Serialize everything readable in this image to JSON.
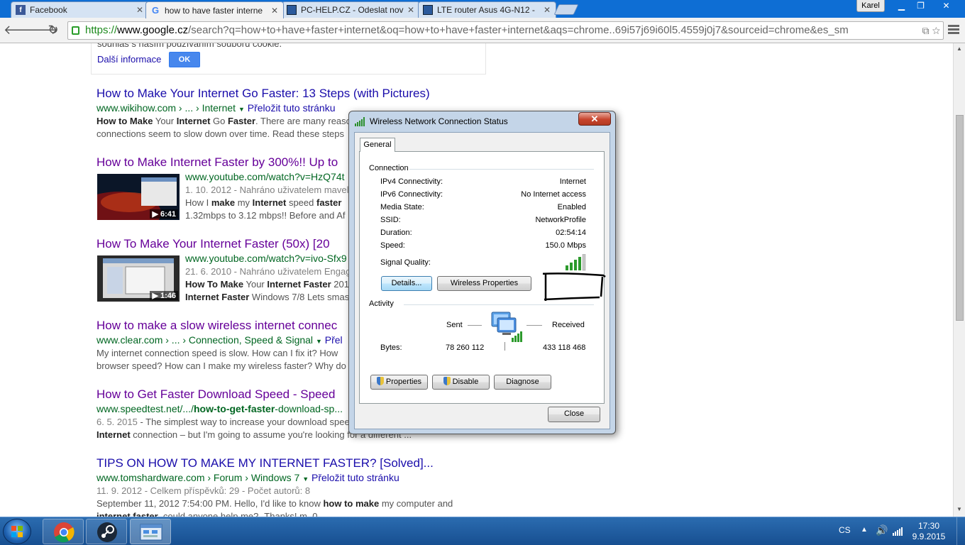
{
  "tabs": [
    {
      "title": "Facebook",
      "icon": "facebook-icon"
    },
    {
      "title": "how to have faster interne",
      "icon": "google-icon",
      "active": true
    },
    {
      "title": "PC-HELP.CZ - Odeslat nov",
      "icon": "document-icon"
    },
    {
      "title": "LTE router Asus 4G-N12 -",
      "icon": "document-icon"
    }
  ],
  "user_badge": "Karel",
  "address": {
    "scheme": "https://",
    "host": "www.google.cz",
    "rest": "/search?q=how+to+have+faster+internet&oq=how+to+have+faster+internet&aqs=chrome..69i57j69i60l5.4559j0j7&sourceid=chrome&es_sm"
  },
  "cookie_notice": {
    "text": "souhlas s naším používáním souborů cookie.",
    "more": "Další informace",
    "ok": "OK"
  },
  "results": [
    {
      "title": "How to Make Your Internet Go Faster: 13 Steps (with Pictures)",
      "url": "www.wikihow.com › ... › Internet",
      "translate": "Přeložit tuto stránku",
      "snippet_1_b": "How to Make",
      "snippet_1_a": " Your ",
      "snippet_1_b2": "Internet",
      "snippet_1_a2": " Go ",
      "snippet_1_b3": "Faster",
      "snippet_1_a3": ". There are many reaso",
      "snippet_2": "connections seem to slow down over time. Read these steps"
    },
    {
      "title": "How to Make Internet Faster by 300%!! Up to",
      "url": "www.youtube.com/watch?v=HzQ74t",
      "meta": "1. 10. 2012 - Nahráno uživatelem mavel",
      "snippet_a": "How I ",
      "snippet_b": "make",
      "snippet_c": " my ",
      "snippet_d": "Internet",
      "snippet_e": " speed ",
      "snippet_f": "faster",
      "snippet_2": "1.32mbps to 3.12 mbps!! Before and Af",
      "duration": "▶ 6:41"
    },
    {
      "title": "How To Make Your Internet Faster (50x) [20",
      "url": "www.youtube.com/watch?v=ivo-Sfx9",
      "meta": "21. 6. 2010 - Nahráno uživatelem Engag",
      "snippet_b": "How To Make",
      "snippet_a": " Your ",
      "snippet_b2": "Internet Faster",
      "snippet_a2": " 201",
      "snippet_2b": "Internet Faster",
      "snippet_2a": " Windows 7/8 Lets smas",
      "duration": "▶ 1:46"
    },
    {
      "title": "How to make a slow wireless internet connec",
      "url": "www.clear.com › ... › Connection, Speed & Signal",
      "translate": "Přel",
      "snippet_1": "My internet connection speed is slow. How can I fix it? How",
      "snippet_2": "browser speed? How can I make my wireless faster? Why do"
    },
    {
      "title": "How to Get Faster Download Speed - Speed",
      "url_a": "www.speedtest.net/.../",
      "url_b": "how-to-get-faster",
      "url_c": "-download-sp...",
      "meta": "6. 5. 2015",
      "snippet_1": " - The simplest way to increase your download spee",
      "snippet_2b": "Internet",
      "snippet_2a": " connection – but I'm going to assume you're looking for a different ..."
    },
    {
      "title": "TIPS ON HOW TO MAKE MY INTERNET FASTER? [Solved]...",
      "url": "www.tomshardware.com › Forum › Windows 7",
      "translate": "Přeložit tuto stránku",
      "meta": "11. 9. 2012 - Celkem příspěvků: 29 - Počet autorů: 8",
      "snippet_1a": "September 11, 2012 7:54:00 PM. Hello, I'd like to know ",
      "snippet_1b": "how to make",
      "snippet_1c": " my computer and",
      "snippet_2b": "internet faster",
      "snippet_2a": ", could anyone help me? -Thanks! m_0"
    }
  ],
  "dialog": {
    "title": "Wireless Network Connection Status",
    "tab": "General",
    "connection_label": "Connection",
    "rows": [
      {
        "label": "IPv4 Connectivity:",
        "value": "Internet"
      },
      {
        "label": "IPv6 Connectivity:",
        "value": "No Internet access"
      },
      {
        "label": "Media State:",
        "value": "Enabled"
      },
      {
        "label": "SSID:",
        "value": "NetworkProfile"
      },
      {
        "label": "Duration:",
        "value": "02:54:14"
      },
      {
        "label": "Speed:",
        "value": "150.0 Mbps"
      }
    ],
    "signal_label": "Signal Quality:",
    "signal_bars": 4,
    "details_button": "Details...",
    "wireless_props_button": "Wireless Properties",
    "activity_label": "Activity",
    "sent_label": "Sent",
    "received_label": "Received",
    "bytes_label": "Bytes:",
    "bytes_sent": "78 260 112",
    "bytes_received": "433 118 468",
    "properties_button": "Properties",
    "disable_button": "Disable",
    "diagnose_button": "Diagnose",
    "close_button": "Close",
    "close_x": "✕"
  },
  "taskbar": {
    "lang": "CS",
    "time": "17:30",
    "date": "9.9.2015"
  },
  "colors": {
    "link": "#1a0dab",
    "visited": "#660099",
    "url_green": "#006621",
    "taskbar": "#1f5ea8"
  }
}
